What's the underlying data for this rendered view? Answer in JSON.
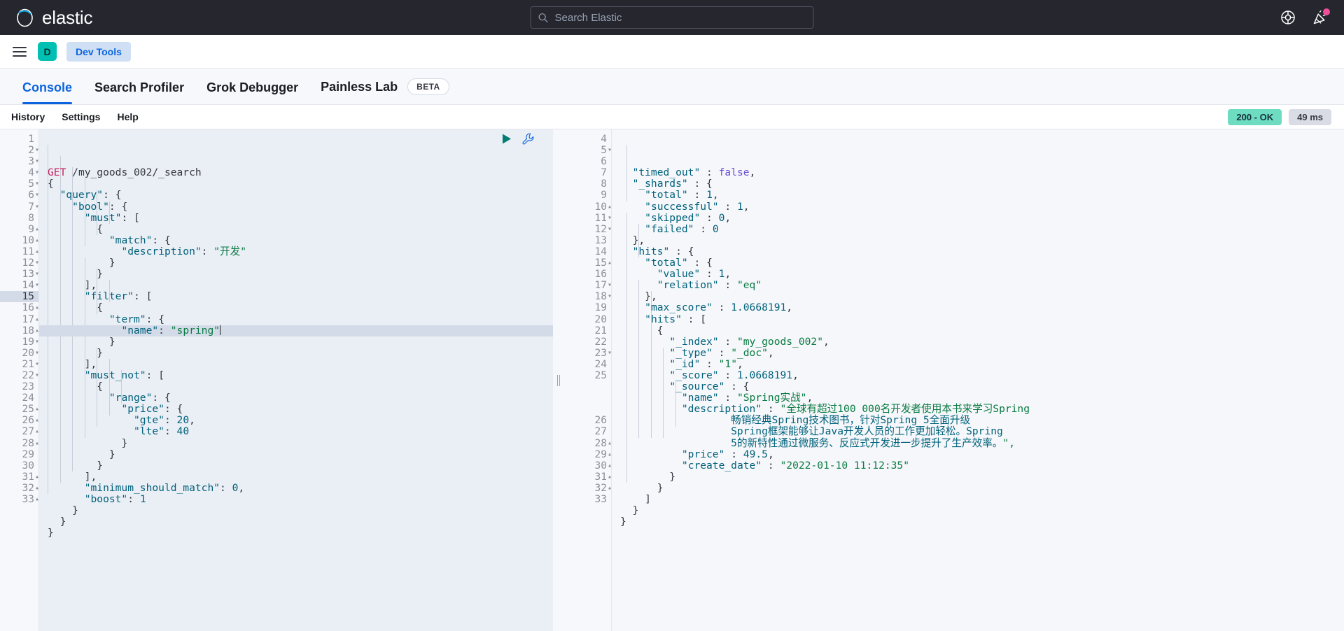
{
  "header": {
    "brand": "elastic",
    "logo_icon": "elastic-circle-logo",
    "search": {
      "placeholder": "Search Elastic",
      "icon": "search-icon",
      "value": ""
    },
    "actions": [
      {
        "name": "help-icon",
        "label": "Help"
      },
      {
        "name": "announcements-icon",
        "label": "Announcements",
        "badge": true
      }
    ],
    "notification_color": "#f04d9b"
  },
  "breadcrumb": {
    "menu_icon": "hamburger-menu-icon",
    "space_initial": "D",
    "space_color": "#00bfb3",
    "app_name": "Dev Tools"
  },
  "tabs": [
    {
      "label": "Console",
      "active": true
    },
    {
      "label": "Search Profiler",
      "active": false
    },
    {
      "label": "Grok Debugger",
      "active": false
    },
    {
      "label": "Painless Lab",
      "active": false,
      "badge": "BETA"
    }
  ],
  "toolbar": {
    "links": [
      "History",
      "Settings",
      "Help"
    ],
    "status_code": "200 - OK",
    "status_color": "#6ddcc1",
    "duration": "49 ms"
  },
  "editor": {
    "run_icon": "play-triangle-icon",
    "wrench_icon": "wrench-icon",
    "active_line": 15,
    "lines": [
      {
        "n": 1,
        "fold": "",
        "text": "GET /my_goods_002/_search"
      },
      {
        "n": 2,
        "fold": "▾",
        "text": "{"
      },
      {
        "n": 3,
        "fold": "▾",
        "text": "  \"query\": {"
      },
      {
        "n": 4,
        "fold": "▾",
        "text": "    \"bool\": {"
      },
      {
        "n": 5,
        "fold": "▾",
        "text": "      \"must\": ["
      },
      {
        "n": 6,
        "fold": "▾",
        "text": "        {"
      },
      {
        "n": 7,
        "fold": "▾",
        "text": "          \"match\": {"
      },
      {
        "n": 8,
        "fold": "",
        "text": "            \"description\": \"开发\""
      },
      {
        "n": 9,
        "fold": "▴",
        "text": "          }"
      },
      {
        "n": 10,
        "fold": "▴",
        "text": "        }"
      },
      {
        "n": 11,
        "fold": "▴",
        "text": "      ],"
      },
      {
        "n": 12,
        "fold": "▾",
        "text": "      \"filter\": ["
      },
      {
        "n": 13,
        "fold": "▾",
        "text": "        {"
      },
      {
        "n": 14,
        "fold": "▾",
        "text": "          \"term\": {"
      },
      {
        "n": 15,
        "fold": "",
        "text": "            \"name\": \"spring\""
      },
      {
        "n": 16,
        "fold": "▴",
        "text": "          }"
      },
      {
        "n": 17,
        "fold": "▴",
        "text": "        }"
      },
      {
        "n": 18,
        "fold": "▴",
        "text": "      ],"
      },
      {
        "n": 19,
        "fold": "▾",
        "text": "      \"must_not\": ["
      },
      {
        "n": 20,
        "fold": "▾",
        "text": "        {"
      },
      {
        "n": 21,
        "fold": "▾",
        "text": "          \"range\": {"
      },
      {
        "n": 22,
        "fold": "▾",
        "text": "            \"price\": {"
      },
      {
        "n": 23,
        "fold": "",
        "text": "              \"gte\": 20,"
      },
      {
        "n": 24,
        "fold": "",
        "text": "              \"lte\": 40"
      },
      {
        "n": 25,
        "fold": "▴",
        "text": "            }"
      },
      {
        "n": 26,
        "fold": "▴",
        "text": "          }"
      },
      {
        "n": 27,
        "fold": "▴",
        "text": "        }"
      },
      {
        "n": 28,
        "fold": "▴",
        "text": "      ],"
      },
      {
        "n": 29,
        "fold": "",
        "text": "      \"minimum_should_match\": 0,"
      },
      {
        "n": 30,
        "fold": "",
        "text": "      \"boost\": 1"
      },
      {
        "n": 31,
        "fold": "▴",
        "text": "    }"
      },
      {
        "n": 32,
        "fold": "▴",
        "text": "  }"
      },
      {
        "n": 33,
        "fold": "▴",
        "text": "}"
      }
    ]
  },
  "response": {
    "lines": [
      {
        "n": 4,
        "fold": "",
        "text": "  \"timed_out\" : false,"
      },
      {
        "n": 5,
        "fold": "▾",
        "text": "  \"_shards\" : {"
      },
      {
        "n": 6,
        "fold": "",
        "text": "    \"total\" : 1,"
      },
      {
        "n": 7,
        "fold": "",
        "text": "    \"successful\" : 1,"
      },
      {
        "n": 8,
        "fold": "",
        "text": "    \"skipped\" : 0,"
      },
      {
        "n": 9,
        "fold": "",
        "text": "    \"failed\" : 0"
      },
      {
        "n": 10,
        "fold": "▴",
        "text": "  },"
      },
      {
        "n": 11,
        "fold": "▾",
        "text": "  \"hits\" : {"
      },
      {
        "n": 12,
        "fold": "▾",
        "text": "    \"total\" : {"
      },
      {
        "n": 13,
        "fold": "",
        "text": "      \"value\" : 1,"
      },
      {
        "n": 14,
        "fold": "",
        "text": "      \"relation\" : \"eq\""
      },
      {
        "n": 15,
        "fold": "▴",
        "text": "    },"
      },
      {
        "n": 16,
        "fold": "",
        "text": "    \"max_score\" : 1.0668191,"
      },
      {
        "n": 17,
        "fold": "▾",
        "text": "    \"hits\" : ["
      },
      {
        "n": 18,
        "fold": "▾",
        "text": "      {"
      },
      {
        "n": 19,
        "fold": "",
        "text": "        \"_index\" : \"my_goods_002\","
      },
      {
        "n": 20,
        "fold": "",
        "text": "        \"_type\" : \"_doc\","
      },
      {
        "n": 21,
        "fold": "",
        "text": "        \"_id\" : \"1\","
      },
      {
        "n": 22,
        "fold": "",
        "text": "        \"_score\" : 1.0668191,"
      },
      {
        "n": 23,
        "fold": "▾",
        "text": "        \"_source\" : {"
      },
      {
        "n": 24,
        "fold": "",
        "text": "          \"name\" : \"Spring实战\","
      },
      {
        "n": 25,
        "fold": "",
        "text": "          \"description\" : \"全球有超过100 000名开发者使用本书来学习Spring"
      },
      {
        "n": "",
        "fold": "",
        "text": "                  畅销经典Spring技术图书，针对Spring 5全面升级"
      },
      {
        "n": "",
        "fold": "",
        "text": "                  Spring框架能够让Java开发人员的工作更加轻松。Spring"
      },
      {
        "n": "",
        "fold": "",
        "text": "                  5的新特性通过微服务、反应式开发进一步提升了生产效率。\","
      },
      {
        "n": 26,
        "fold": "",
        "text": "          \"price\" : 49.5,"
      },
      {
        "n": 27,
        "fold": "",
        "text": "          \"create_date\" : \"2022-01-10 11:12:35\""
      },
      {
        "n": 28,
        "fold": "▴",
        "text": "        }"
      },
      {
        "n": 29,
        "fold": "▴",
        "text": "      }"
      },
      {
        "n": 30,
        "fold": "▴",
        "text": "    ]"
      },
      {
        "n": 31,
        "fold": "▴",
        "text": "  }"
      },
      {
        "n": 32,
        "fold": "▴",
        "text": "}"
      },
      {
        "n": 33,
        "fold": "",
        "text": ""
      }
    ]
  }
}
